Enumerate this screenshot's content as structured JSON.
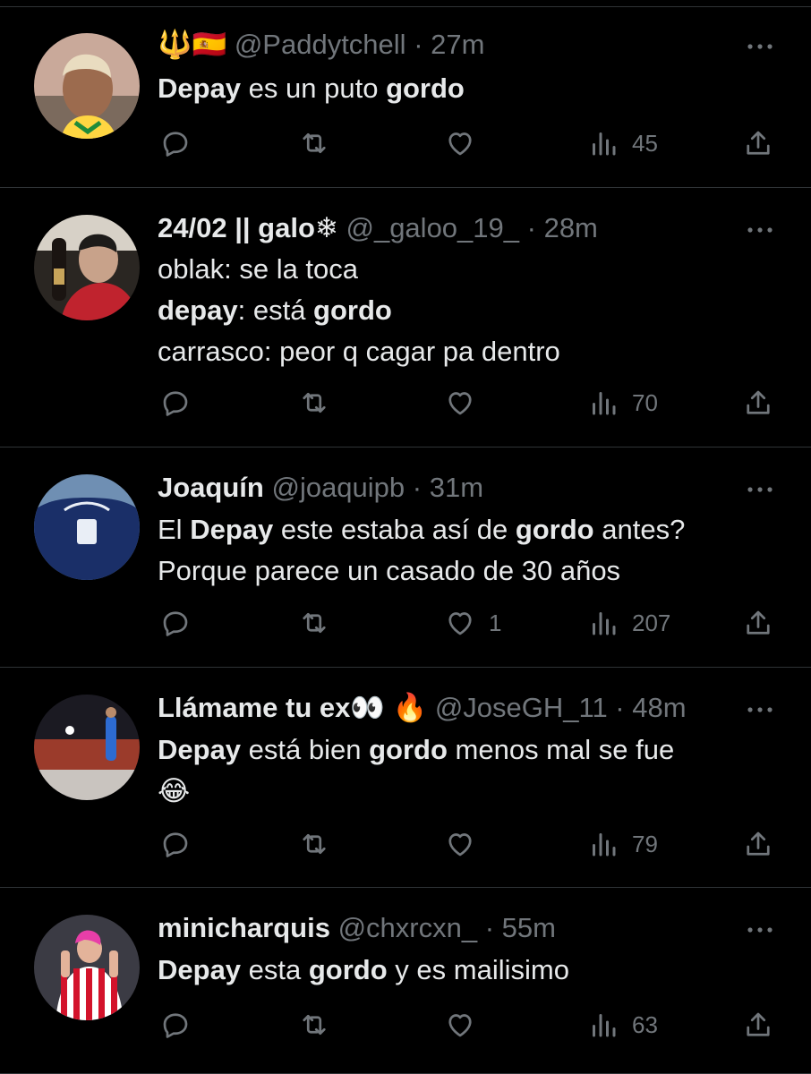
{
  "tweets": [
    {
      "display_name": "🔱🇪🇸",
      "handle": "@Paddytchell",
      "time": "27m",
      "lines": [
        [
          {
            "t": "Depay",
            "b": true
          },
          {
            "t": " es un puto ",
            "b": false
          },
          {
            "t": "gordo",
            "b": true
          }
        ]
      ],
      "likes": "",
      "views": "45"
    },
    {
      "display_name": "24/02 || galo❄",
      "handle": "@_galoo_19_",
      "time": "28m",
      "lines": [
        [
          {
            "t": "oblak: se la toca",
            "b": false
          }
        ],
        [
          {
            "t": "depay",
            "b": true
          },
          {
            "t": ": está ",
            "b": false
          },
          {
            "t": "gordo",
            "b": true
          }
        ],
        [
          {
            "t": "carrasco: peor q cagar pa dentro",
            "b": false
          }
        ]
      ],
      "likes": "",
      "views": "70"
    },
    {
      "display_name": "Joaquín",
      "handle": "@joaquipb",
      "time": "31m",
      "lines": [
        [
          {
            "t": "El ",
            "b": false
          },
          {
            "t": "Depay",
            "b": true
          },
          {
            "t": " este estaba así de ",
            "b": false
          },
          {
            "t": "gordo",
            "b": true
          },
          {
            "t": " antes?",
            "b": false
          }
        ],
        [
          {
            "t": "Porque parece un casado de 30 años",
            "b": false
          }
        ]
      ],
      "likes": "1",
      "views": "207"
    },
    {
      "display_name": "Llámame tu ex👀 🔥",
      "handle": "@JoseGH_11",
      "time": "48m",
      "lines": [
        [
          {
            "t": "Depay",
            "b": true
          },
          {
            "t": " está bien ",
            "b": false
          },
          {
            "t": "gordo",
            "b": true
          },
          {
            "t": " menos mal se fue",
            "b": false
          }
        ],
        [
          {
            "t": "😂",
            "b": false
          }
        ]
      ],
      "likes": "",
      "views": "79"
    },
    {
      "display_name": "minicharquis",
      "handle": "@chxrcxn_",
      "time": "55m",
      "lines": [
        [
          {
            "t": "Depay",
            "b": true
          },
          {
            "t": " esta ",
            "b": false
          },
          {
            "t": "gordo",
            "b": true
          },
          {
            "t": " y es mailisimo",
            "b": false
          }
        ]
      ],
      "likes": "",
      "views": "63"
    }
  ],
  "separator": " · ",
  "colors": {
    "background": "#000000",
    "text": "#e7e9ea",
    "muted": "#71767b",
    "divider": "#2f3336"
  },
  "icons": {
    "reply": "reply-icon",
    "retweet": "retweet-icon",
    "like": "like-icon",
    "views": "views-icon",
    "share": "share-icon",
    "more": "more-icon"
  }
}
